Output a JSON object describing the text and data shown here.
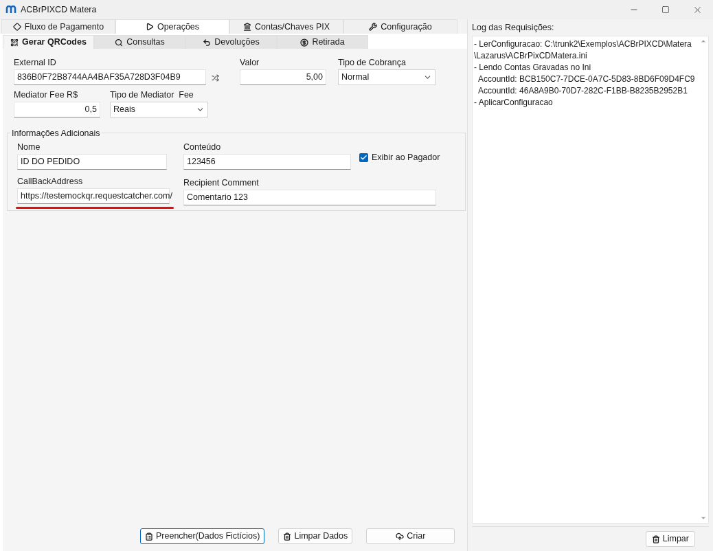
{
  "window": {
    "title": "ACBrPIXCD Matera"
  },
  "tabs": [
    {
      "label": "Fluxo de Pagamento",
      "selected": false
    },
    {
      "label": "Operações",
      "selected": true
    },
    {
      "label": "Contas/Chaves PIX",
      "selected": false
    },
    {
      "label": "Configuração",
      "selected": false
    }
  ],
  "subtabs": [
    {
      "label": "Gerar QRCodes",
      "selected": true
    },
    {
      "label": "Consultas",
      "selected": false
    },
    {
      "label": "Devoluções",
      "selected": false
    },
    {
      "label": "Retirada",
      "selected": false
    }
  ],
  "form": {
    "external_id": {
      "label": "External ID",
      "value": "836B0F72B8744AA4BAF35A728D3F04B9"
    },
    "valor": {
      "label": "Valor",
      "value": "5,00"
    },
    "tipo_cobranca": {
      "label": "Tipo de Cobrança",
      "value": "Normal"
    },
    "mediator_fee": {
      "label": "Mediator Fee R$",
      "value": "0,5"
    },
    "tipo_mediator_fee": {
      "label": "Tipo de Mediator  Fee",
      "value": "Reais"
    }
  },
  "info": {
    "title": "Informações Adicionais",
    "nome": {
      "label": "Nome",
      "value": "ID DO PEDIDO"
    },
    "conteudo": {
      "label": "Conteúdo",
      "value": "123456"
    },
    "exibir": {
      "label": "Exibir ao Pagador",
      "checked": true
    },
    "callback": {
      "label": "CallBackAddress",
      "value": "https://testemockqr.requestcatcher.com/"
    },
    "comment": {
      "label": "Recipient Comment",
      "value": "Comentario 123"
    }
  },
  "buttons": [
    {
      "label": "Preencher(Dados Fictícios)",
      "focused": true
    },
    {
      "label": "Limpar Dados",
      "focused": false
    },
    {
      "label": "Criar",
      "focused": false
    }
  ],
  "log": {
    "title": "Log das Requisições:",
    "lines": [
      "- LerConfiguracao: C:\\trunk2\\Exemplos\\ACBrPIXCD\\Matera",
      "\\Lazarus\\ACBrPixCDMatera.ini",
      "- Lendo Contas Gravadas no Ini",
      "  AccountId: BCB150C7-7DCE-0A7C-5D83-8BD6F09D4FC9",
      "  AccountId: 46A8A9B0-70D7-282C-F1BB-B8235B2952B1",
      "- AplicarConfiguracao"
    ],
    "button": "Limpar"
  }
}
